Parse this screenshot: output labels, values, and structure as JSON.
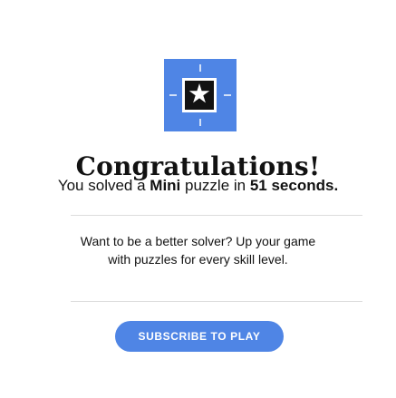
{
  "brand": {
    "accent_color": "#4f85e5",
    "icon": "mini-crossword-star-icon"
  },
  "headline": "Congratulations!",
  "result": {
    "prefix": "You solved a ",
    "puzzle_name": "Mini",
    "middle": " puzzle in ",
    "time": "51 seconds",
    "suffix": "."
  },
  "promo": {
    "line1": "Want to be a better solver? Up your game",
    "line2": "with puzzles for every skill level."
  },
  "cta": {
    "label": "SUBSCRIBE TO PLAY"
  }
}
